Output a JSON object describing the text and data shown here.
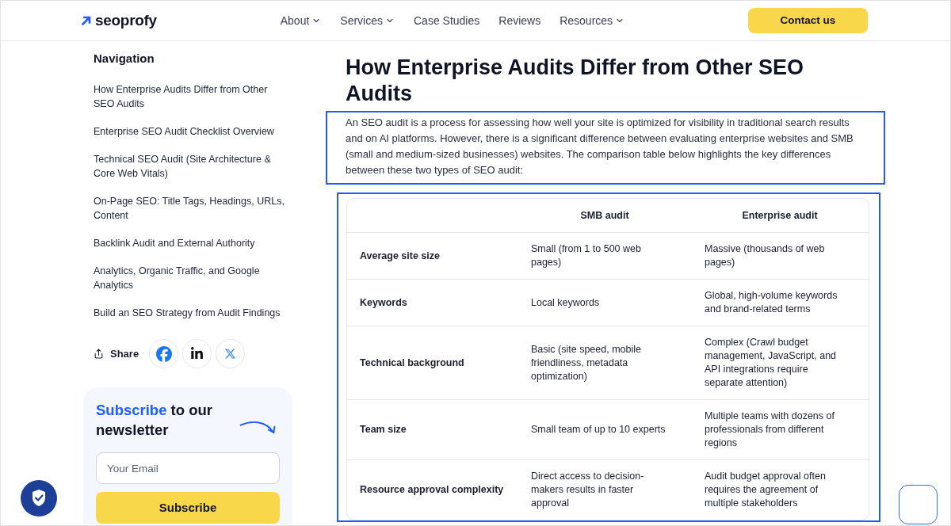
{
  "header": {
    "logo": "seoprofy",
    "nav": [
      {
        "label": "About",
        "dropdown": true
      },
      {
        "label": "Services",
        "dropdown": true
      },
      {
        "label": "Case Studies",
        "dropdown": false
      },
      {
        "label": "Reviews",
        "dropdown": false
      },
      {
        "label": "Resources",
        "dropdown": true
      }
    ],
    "cta": "Contact us"
  },
  "sidebar": {
    "title": "Navigation",
    "items": [
      "How Enterprise Audits Differ from Other SEO Audits",
      "Enterprise SEO Audit Checklist Overview",
      "Technical SEO Audit (Site Architecture & Core Web Vitals)",
      "On-Page SEO: Title Tags, Headings, URLs, Content",
      "Backlink Audit and External Authority",
      "Analytics, Organic Traffic, and Google Analytics",
      "Build an SEO Strategy from Audit Findings"
    ],
    "share": {
      "label": "Share",
      "networks": [
        {
          "kind": "facebook"
        },
        {
          "kind": "linkedin"
        },
        {
          "kind": "x"
        }
      ]
    },
    "newsletter": {
      "title": [
        {
          "text": "Subscribe",
          "highlight": true
        },
        {
          "text": " to our newsletter",
          "highlight": false
        }
      ],
      "email_placeholder": "Your Email",
      "button": "Subscribe"
    }
  },
  "article": {
    "title": "How Enterprise Audits Differ from Other SEO Audits",
    "intro": {
      "text": "An SEO audit is a process for assessing how well your site is optimized for visibility in traditional search results and on AI platforms. However, there is a significant difference between evaluating enterprise websites and SMB (small and medium-sized businesses) websites. The comparison table below highlights the key differences between these two types of SEO audit:",
      "highlighted": true
    },
    "table": {
      "highlighted": true,
      "columns": [
        "SMB audit",
        "Enterprise audit"
      ],
      "rows": [
        {
          "label": "Average site size",
          "cells": [
            "Small (from 1 to 500 web pages)",
            "Massive (thousands of web pages)"
          ]
        },
        {
          "label": "Keywords",
          "cells": [
            "Local keywords",
            "Global, high-volume keywords and brand-related terms"
          ]
        },
        {
          "label": "Technical background",
          "cells": [
            "Basic (site speed, mobile friendliness, metadata optimization)",
            "Complex (Crawl budget management, JavaScript, and API integrations require separate attention)"
          ]
        },
        {
          "label": "Team size",
          "cells": [
            "Small team of up to 10 experts",
            "Multiple teams with dozens of professionals from different regions"
          ]
        },
        {
          "label": "Resource approval complexity",
          "cells": [
            "Direct access to decision-makers results in faster approval",
            "Audit budget approval often requires the agreement of multiple stakeholders"
          ]
        }
      ]
    }
  }
}
